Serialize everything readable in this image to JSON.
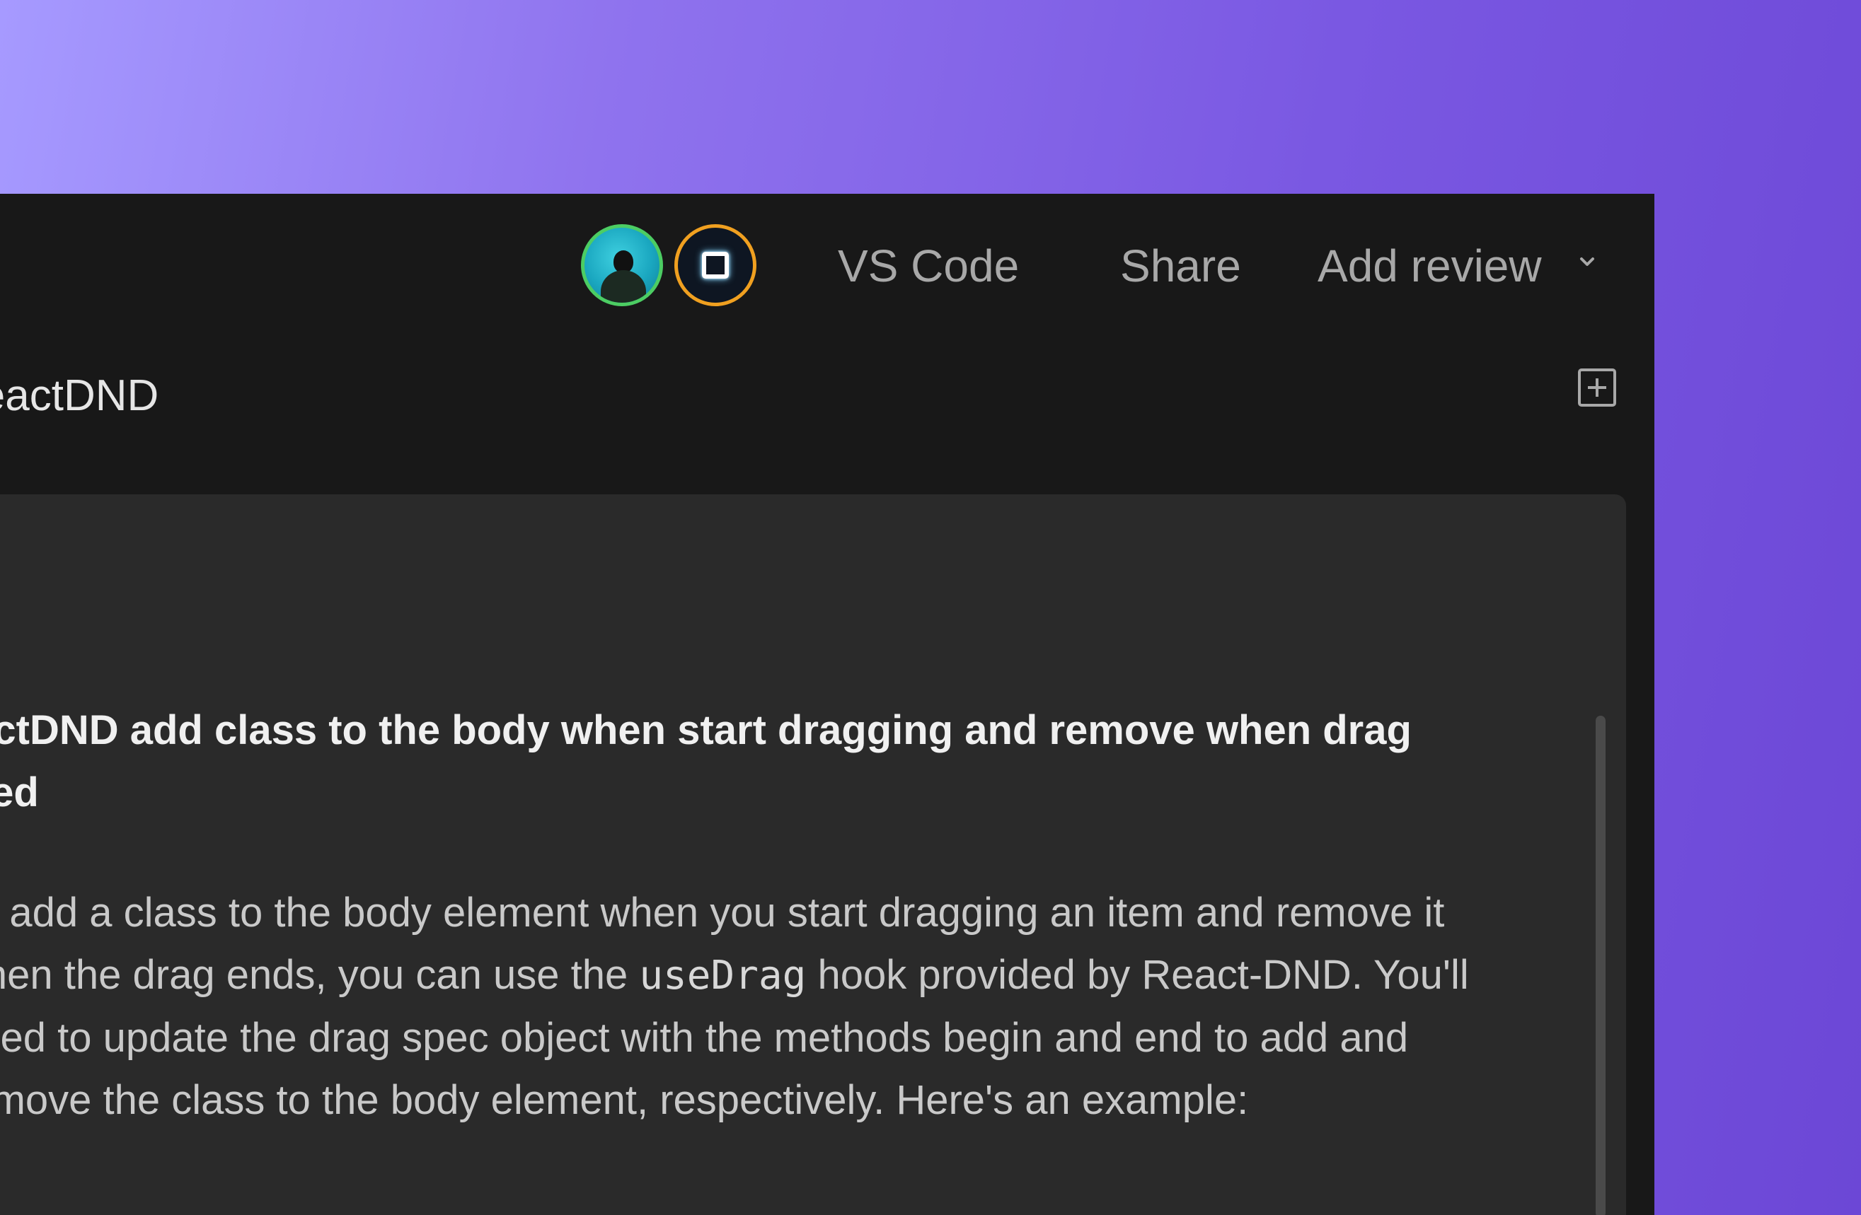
{
  "topbar": {
    "vscode_label": "VS Code",
    "share_label": "Share",
    "review_label": "Add review"
  },
  "document": {
    "title": "ReactDND"
  },
  "conversation": {
    "question": "ReactDND add class to the body when start dragging and remove when drag ended",
    "answer_part1": "To add a class to the body element when you start dragging an item and remove it when the drag ends, you can use the ",
    "answer_code": "useDrag",
    "answer_part2": " hook provided by React-DND. You'll need to update the drag spec object with the methods begin and end to add and remove the class to the body element, respectively. Here's an example:"
  },
  "colors": {
    "background_start": "#a69aff",
    "background_end": "#6c47d6",
    "window": "#181818",
    "panel": "#2a2a2a",
    "user_avatar_ring": "#4ccd63",
    "bot_avatar_ring": "#f0a020"
  }
}
